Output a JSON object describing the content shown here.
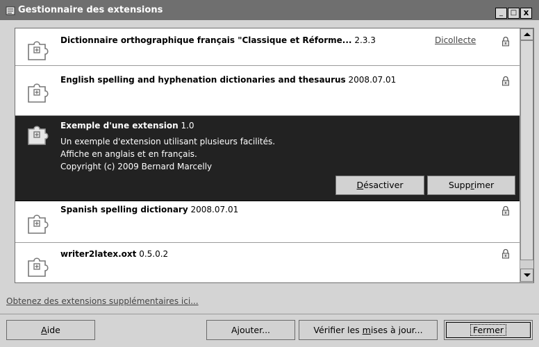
{
  "window": {
    "title": "Gestionnaire des extensions",
    "buttons": {
      "minimize": "_",
      "maximize": "□",
      "close": "x"
    }
  },
  "extensions": [
    {
      "name": "Dictionnaire orthographique français \"Classique et Réforme...",
      "version": "2.3.3",
      "link": "Dicollecte",
      "icon": "puzzle-icon",
      "lock": "lock-icon"
    },
    {
      "name": "English spelling and hyphenation dictionaries and thesaurus",
      "version": "2008.07.01",
      "icon": "puzzle-icon",
      "lock": "lock-icon"
    },
    {
      "name": "Exemple d'une extension",
      "version": "1.0",
      "selected": true,
      "description": [
        "Un exemple d'extension utilisant plusieurs facilités.",
        "Affiche en anglais et en français.",
        "Copyright (c) 2009 Bernard Marcelly"
      ],
      "buttons": {
        "disable_pre": "",
        "disable_key": "D",
        "disable_post": "ésactiver",
        "remove_pre": "Supp",
        "remove_key": "r",
        "remove_post": "imer"
      },
      "icon": "puzzle-icon"
    },
    {
      "name": "Spanish spelling dictionary",
      "version": "2008.07.01",
      "icon": "puzzle-icon",
      "lock": "lock-icon"
    },
    {
      "name": "writer2latex.oxt",
      "version": "0.5.0.2",
      "icon": "puzzle-icon",
      "lock": "lock-icon"
    }
  ],
  "more_link": "Obtenez des extensions supplémentaires ici...",
  "footer": {
    "help_key": "A",
    "help_rest": "ide",
    "add": "Ajouter...",
    "update_pre": "Vérifier les ",
    "update_key": "m",
    "update_post": "ises à jour...",
    "close": "Fermer"
  },
  "colors": {
    "titlebar": "#6f6f6f",
    "selected_row": "#222222",
    "background": "#d4d4d4"
  }
}
